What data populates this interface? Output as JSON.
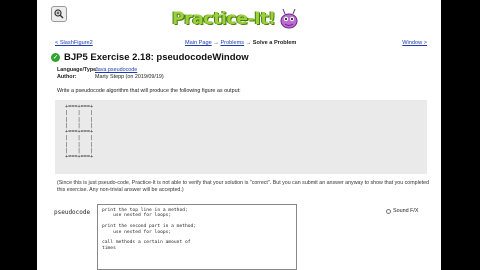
{
  "nav": {
    "prev_link": "< SlashFigure2",
    "main_page": "Main Page",
    "arrow1": " → ",
    "problems": "Problems",
    "arrow2": " → ",
    "current": "Solve a Problem",
    "next_link": "Window >"
  },
  "logo": {
    "text": "Practice-It!"
  },
  "problem": {
    "title": "BJP5 Exercise 2.18: pseudocodeWindow",
    "language_key": "Language/Type:",
    "language_val": "Java pseudocode",
    "author_key": "Author:",
    "author_val": "Marty Stepp (on 2019/09/19)",
    "description": "Write a pseudocode algorithm that will produce the following figure as output:",
    "figure": "+===+===+\n|   |   |\n|   |   |\n|   |   |\n+===+===+\n|   |   |\n|   |   |\n|   |   |\n+===+===+",
    "note": "(Since this is just pseudo-code, Practice-It is not able to verify that your solution is \"correct\". But you can submit an answer anyway to show that you completed this exercise. Any non-trivial answer will be accepted.)"
  },
  "editor": {
    "label": "pseudocode",
    "content": "print the top line in a method;\n    use nested for loops;\n\nprint the second part in a method;\n    use nested for loops;\n\ncall methods a certain amount of\ntimes",
    "sound_label": "Sound F/X"
  },
  "colors": {
    "link": "#1a3bb0",
    "logo": "#9bd13a",
    "check": "#2fa32f"
  }
}
